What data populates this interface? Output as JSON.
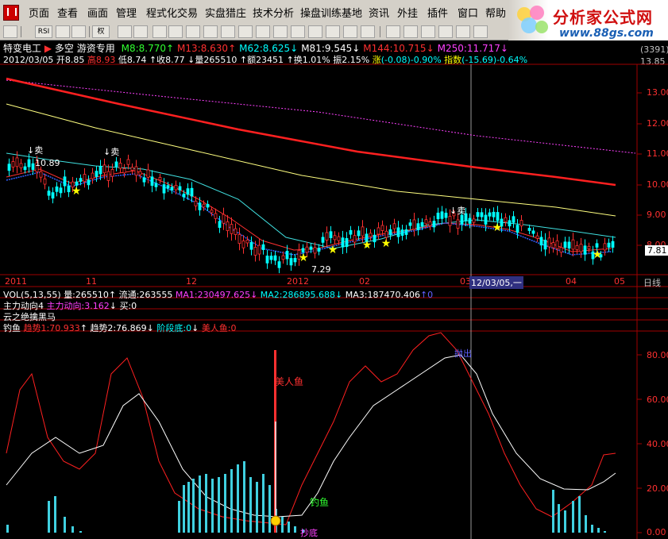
{
  "menu": {
    "items": [
      "页面",
      "查看",
      "画面",
      "管理",
      "程式化交易",
      "实盘猎庄",
      "技术分析",
      "操盘训练基地",
      "资讯",
      "外挂",
      "插件",
      "窗口",
      "帮助"
    ]
  },
  "logo": {
    "main": "分析家公式网",
    "sub": "www.88gs.com"
  },
  "toolbar": {
    "rsi_label": "RSI",
    "quan_label": "权"
  },
  "stock": {
    "name": "特变电工",
    "mode": "多空",
    "mode2": "游资专用",
    "ma_values": [
      {
        "label": "M8:",
        "value": "8.770",
        "arrow": "↑",
        "color": "#30ff30"
      },
      {
        "label": "M13:",
        "value": "8.630",
        "arrow": "↑",
        "color": "#ff3030"
      },
      {
        "label": "M62:",
        "value": "8.625",
        "arrow": "↓",
        "color": "#00ffff"
      },
      {
        "label": "M81:",
        "value": "9.545",
        "arrow": "↓",
        "color": "#ffffff"
      },
      {
        "label": "M144:",
        "value": "10.715",
        "arrow": "↓",
        "color": "#ff3030"
      },
      {
        "label": "M250:",
        "value": "11.717",
        "arrow": "↓",
        "color": "#ff40ff"
      }
    ],
    "date": "2012/03/05",
    "open_label": "开",
    "open": "8.85",
    "high_label": "高",
    "high": "8.93",
    "low_label": "低",
    "low": "8.74",
    "close_label": "收",
    "close": "8.77",
    "vol_label": "量",
    "vol": "265510",
    "amt_label": "额",
    "amt": "23451",
    "turn_label": "换",
    "turn": "1.01%",
    "amp_label": "振",
    "amp": "2.15%",
    "chg_label": "涨",
    "chg": "(-0.08)-0.90%",
    "idx_label": "指数",
    "idx": "(-15.69)-0.64%",
    "code": "(3391)",
    "ref_price": "13.85",
    "current_price": "7.81",
    "high_marker": "10.89",
    "low_marker": "7.29",
    "sell_label": "卖"
  },
  "price_axis": {
    "ticks": [
      "13.00",
      "12.00",
      "11.00",
      "10.00",
      "9.00",
      "8.00"
    ]
  },
  "time_axis": {
    "labels": [
      "2011",
      "11",
      "12",
      "2012",
      "02",
      "03",
      "04",
      "05"
    ],
    "cursor_label": "12/03/05,一",
    "period": "日线"
  },
  "vol_bar": {
    "title": "VOL(5,13,55)",
    "vol_label": "量:",
    "vol": "265510",
    "float_label": "流通:",
    "float": "263555",
    "ma1_label": "MA1:",
    "ma1": "230497.625",
    "ma2_label": "MA2:",
    "ma2": "286895.688",
    "ma3_label": "MA3:",
    "ma3": "187470.406"
  },
  "flow_bar": {
    "title": "主力动向4",
    "main_label": "主力动向:",
    "main": "3.162",
    "buy_label": "买:",
    "buy": "0"
  },
  "cloud_bar": {
    "title": "云之绝擒黑马"
  },
  "fish": {
    "title": "钓鱼",
    "t1_label": "趋势1:",
    "t1": "70.933",
    "t2_label": "趋势2:",
    "t2": "76.869",
    "stage_label": "阶段底:",
    "stage": "0",
    "mermaid_label": "美人鱼:",
    "mermaid": "0",
    "ticks": [
      "80.00",
      "60.00",
      "40.00",
      "20.00",
      "0.00"
    ],
    "annot_mermaid": "美人鱼",
    "annot_fish": "钓鱼",
    "annot_sell": "抛出",
    "annot_bottom": "抄底"
  },
  "colors": {
    "axis": "#a00000",
    "up": "#ff3030",
    "down": "#00ffff",
    "accent": "#ff3030"
  }
}
